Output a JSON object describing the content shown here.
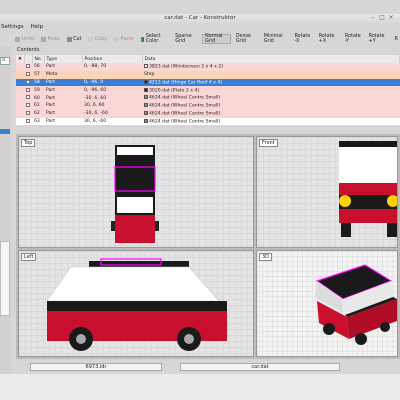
{
  "window": {
    "title": "car.dat - Car - Konstruktor"
  },
  "menu": [
    "Settings",
    "Help"
  ],
  "toolbar": {
    "undo": "Undo",
    "redo": "Redo",
    "cut": "Cut",
    "copy": "Copy",
    "paste": "Paste",
    "select_color": "Select Color",
    "sparse_grid": "Sparse Grid",
    "normal_grid": "Normal Grid",
    "dense_grid": "Dense Grid",
    "minimal_grid": "Minimal Grid",
    "rotate_neg_x": "Rotate -X",
    "rotate_pos_x": "Rotate +X",
    "rotate_neg_y": "Rotate -Y",
    "rotate_pos_y": "Rotate +Y",
    "rotate_more": "R"
  },
  "sidebar": {
    "selected_label": "d"
  },
  "contents": {
    "header": "Contents",
    "columns": [
      "No.",
      "Type",
      "Position",
      "Data"
    ],
    "rows": [
      {
        "no": "56",
        "type": "Part",
        "pos": "0, -88, 70",
        "data": "3823.dat (Windscreen 2 x 4 x 2)",
        "style": "pink",
        "swatch": "#fff"
      },
      {
        "no": "57",
        "type": "Meta",
        "pos": "",
        "data": "Step",
        "style": "orange",
        "swatch": ""
      },
      {
        "no": "58",
        "type": "Part",
        "pos": "0, -96, 0",
        "data": "4213.dat (Hinge Car Roof 4 x 4)",
        "style": "sel",
        "swatch": "#222"
      },
      {
        "no": "59",
        "type": "Part",
        "pos": "0, -96, 60",
        "data": "3020.dat (Plate 2 x 4)",
        "style": "pink",
        "swatch": "#222"
      },
      {
        "no": "60",
        "type": "Part",
        "pos": "-30, 6, 60",
        "data": "4624.dat (Wheel Centre Small)",
        "style": "pink",
        "swatch": "#888"
      },
      {
        "no": "61",
        "type": "Part",
        "pos": "30, 6, 60",
        "data": "4624.dat (Wheel Centre Small)",
        "style": "pink",
        "swatch": "#888"
      },
      {
        "no": "62",
        "type": "Part",
        "pos": "-30, 6, -60",
        "data": "4624.dat (Wheel Centre Small)",
        "style": "pink",
        "swatch": "#888"
      },
      {
        "no": "63",
        "type": "Part",
        "pos": "30, 6, -60",
        "data": "4624.dat (Wheel Centre Small)",
        "style": "white",
        "swatch": "#888"
      }
    ]
  },
  "views": {
    "top": "Top",
    "front": "Front",
    "left": "Left",
    "three_d": "3D"
  },
  "status": {
    "left": "6973.ldr",
    "right": "car.dat"
  },
  "colors": {
    "car_red": "#c8102e",
    "car_black": "#1a1a1a",
    "window_white": "#ffffff",
    "highlight_magenta": "#ff00ff",
    "yellow_light": "#ffd200",
    "selection_blue": "#3a7fd4"
  }
}
